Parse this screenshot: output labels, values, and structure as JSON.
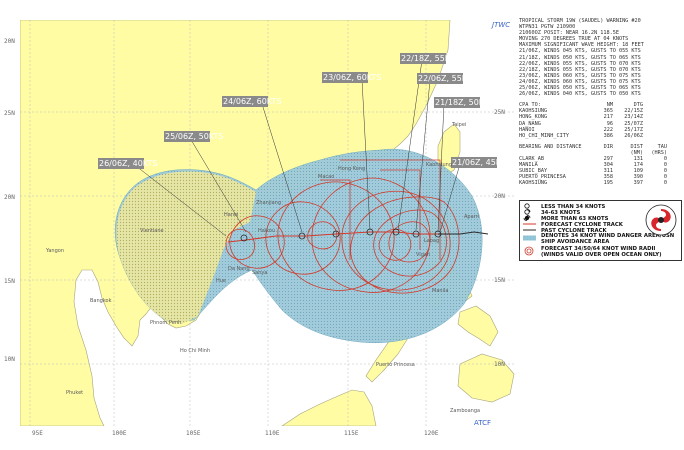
{
  "map": {
    "header": "JTWC",
    "footer": "ATCF",
    "lat_labels": [
      "20N",
      "25N",
      "20N",
      "15N",
      "10N"
    ],
    "lon_labels": [
      "95E",
      "100E",
      "105E",
      "110E",
      "115E",
      "120E"
    ],
    "places": [
      "Taipei",
      "Kaohsiung",
      "Hong Kong",
      "Macao",
      "Zhanjiang",
      "Haikou",
      "Sanya",
      "Da Nang",
      "Hue",
      "Hanoi",
      "Vientiane",
      "Yangon",
      "Bangkok",
      "Phnom Penh",
      "Ho Chi Minh",
      "Phuket",
      "Puerto Princesa",
      "Zamboanga",
      "Manila",
      "Aparri",
      "Vigan",
      "Laoag"
    ],
    "forecast_labels": [
      {
        "label": "22/18Z, 55KTS"
      },
      {
        "label": "23/06Z, 60KTS"
      },
      {
        "label": "22/06Z, 55KTS"
      },
      {
        "label": "21/18Z, 50KTS"
      },
      {
        "label": "21/06Z, 45KTS"
      },
      {
        "label": "24/06Z, 60KTS"
      },
      {
        "label": "25/06Z, 50KTS"
      },
      {
        "label": "26/06Z, 40KTS"
      }
    ]
  },
  "warning": {
    "lines": [
      "TROPICAL STORM 19W (SAUDEL) WARNING #20",
      "WTPN31 PGTW 210900",
      "21060OZ POSIT: NEAR 16.2N 118.5E",
      "MOVING 270 DEGREES TRUE AT 04 KNOTS",
      "MAXIMUM SIGNIFICANT WAVE HEIGHT: 18 FEET",
      "21/06Z, WINDS 045 KTS, GUSTS TO 055 KTS",
      "21/18Z, WINDS 050 KTS, GUSTS TO 065 KTS",
      "22/06Z, WINDS 055 KTS, GUSTS TO 070 KTS",
      "22/18Z, WINDS 055 KTS, GUSTS TO 070 KTS",
      "23/06Z, WINDS 060 KTS, GUSTS TO 075 KTS",
      "24/06Z, WINDS 060 KTS, GUSTS TO 075 KTS",
      "25/06Z, WINDS 050 KTS, GUSTS TO 065 KTS",
      "26/06Z, WINDS 040 KTS, GUSTS TO 050 KTS"
    ]
  },
  "cpa": {
    "header": [
      "CPA TO:",
      "NM",
      "DTG"
    ],
    "rows": [
      [
        "KAOHSIUNG",
        "365",
        "22/15Z"
      ],
      [
        "HONG_KONG",
        "217",
        "23/14Z"
      ],
      [
        "DA_NANG",
        "96",
        "25/07Z"
      ],
      [
        "HANOI",
        "222",
        "25/17Z"
      ],
      [
        "HO_CHI_MINH_CITY",
        "386",
        "26/06Z"
      ]
    ]
  },
  "bearing": {
    "header": [
      "BEARING AND DISTANCE",
      "DIR",
      "DIST",
      "TAU"
    ],
    "subheader": [
      "",
      "",
      "(NM)",
      "(HRS)"
    ],
    "rows": [
      [
        "CLARK_AB",
        "297",
        "131",
        "0"
      ],
      [
        "MANILA",
        "304",
        "174",
        "0"
      ],
      [
        "SUBIC_BAY",
        "311",
        "109",
        "0"
      ],
      [
        "PUERTO_PRINCESA",
        "358",
        "390",
        "0"
      ],
      [
        "KAOHSIUNG",
        "195",
        "397",
        "0"
      ]
    ]
  },
  "legend": {
    "items": [
      "LESS THAN 34 KNOTS",
      "34-63 KNOTS",
      "MORE THAN 63 KNOTS",
      "FORECAST CYCLONE TRACK",
      "PAST CYCLONE TRACK",
      "DENOTES 34 KNOT WIND DANGER AREA/USN SHIP AVOIDANCE AREA",
      "FORECAST 34/50/64 KNOT WIND RADII (WINDS VALID OVER OPEN OCEAN ONLY)"
    ],
    "colors": {
      "forecast_track": "#d23a2a",
      "past_track": "#2a2a2a",
      "danger": "#8fc4d6",
      "radii": "#d23a2a"
    }
  }
}
